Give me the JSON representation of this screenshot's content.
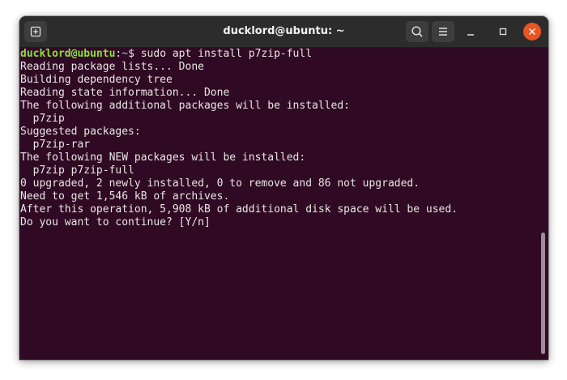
{
  "window": {
    "title": "ducklord@ubuntu: ~"
  },
  "headerbar": {
    "new_tab_icon": "new-tab-icon",
    "search_icon": "search-icon",
    "menu_icon": "hamburger-menu-icon",
    "minimize_icon": "minimize-icon",
    "maximize_icon": "maximize-icon",
    "close_icon": "close-icon"
  },
  "colors": {
    "terminal_bg": "#300a24",
    "prompt_user": "#8ae234",
    "prompt_path": "#729fcf",
    "close_button": "#e95420",
    "headerbar_bg": "#2c2c2c"
  },
  "terminal": {
    "prompt": {
      "user_host": "ducklord@ubuntu",
      "separator": ":",
      "path": "~",
      "symbol": "$",
      "command": " sudo apt install p7zip-full"
    },
    "output": [
      "Reading package lists... Done",
      "Building dependency tree",
      "Reading state information... Done",
      "The following additional packages will be installed:",
      "  p7zip",
      "Suggested packages:",
      "  p7zip-rar",
      "The following NEW packages will be installed:",
      "  p7zip p7zip-full",
      "0 upgraded, 2 newly installed, 0 to remove and 86 not upgraded.",
      "Need to get 1,546 kB of archives.",
      "After this operation, 5,908 kB of additional disk space will be used.",
      "Do you want to continue? [Y/n] "
    ]
  }
}
